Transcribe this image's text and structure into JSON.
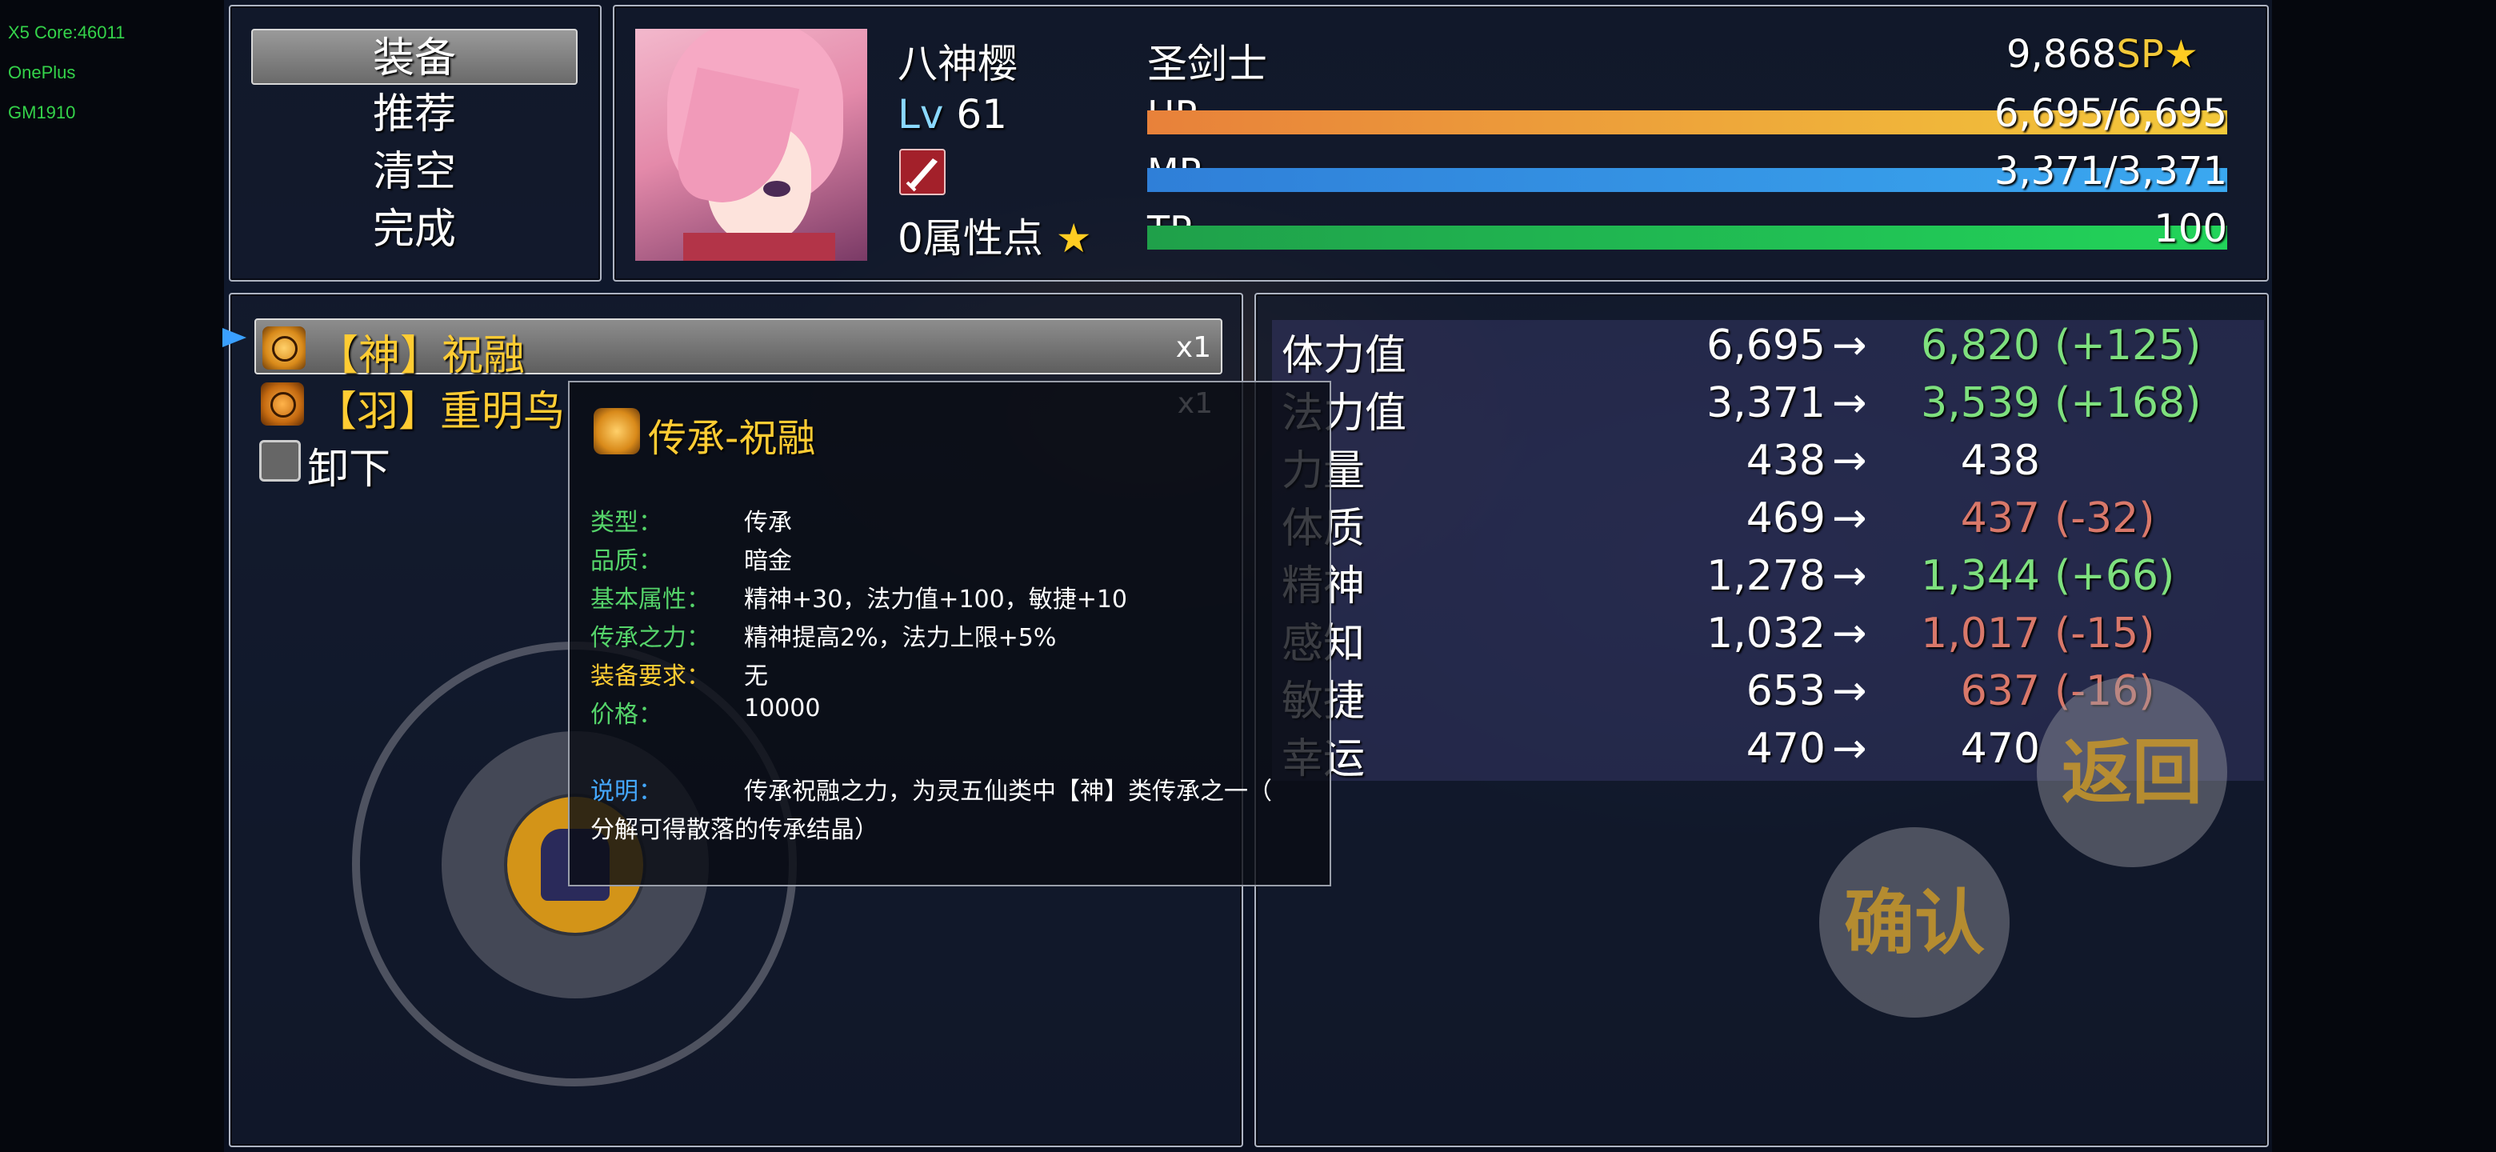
{
  "device": {
    "line1": "X5 Core:46011",
    "line2": "OnePlus",
    "line3": "GM1910"
  },
  "commands": [
    "装备",
    "推荐",
    "清空",
    "完成"
  ],
  "actor": {
    "name": "八神樱",
    "class": "圣剑士",
    "level_label": "Lv",
    "level": "61",
    "sp_value": "9,868",
    "sp_unit": "SP",
    "points_label": "0属性点",
    "hp_label": "HP",
    "hp_text": "6,695/6,695",
    "hp_ratio": 1.0,
    "mp_label": "MP",
    "mp_text": "3,371/3,371",
    "mp_ratio": 1.0,
    "tp_label": "TP",
    "tp_text": "100",
    "tp_ratio": 1.0
  },
  "items": [
    {
      "name": "【神】祝融",
      "count": "x1",
      "color": "#ffcc33"
    },
    {
      "name": "【羽】重明鸟",
      "count": "x1",
      "color": "#ffcc33"
    },
    {
      "name": "卸下",
      "count": "",
      "color": "#ffffff"
    }
  ],
  "tooltip": {
    "title": "传承-祝融",
    "rows": [
      {
        "k": "类型：",
        "v": "传承",
        "color": "#55d46a"
      },
      {
        "k": "品质：",
        "v": "暗金",
        "color": "#55d46a"
      },
      {
        "k": "基本属性：",
        "v": "精神+30，法力值+100，敏捷+10",
        "color": "#55d46a"
      },
      {
        "k": "传承之力：",
        "v": "精神提高2%，法力上限+5%",
        "color": "#55d46a"
      },
      {
        "k": "装备要求：",
        "v": "无",
        "color": "#ffcc33"
      },
      {
        "k": "价格：",
        "v": "10000",
        "color": "#55d46a"
      }
    ],
    "desc_label": "说明：",
    "desc_line1": "传承祝融之力，为灵五仙类中【神】类传承之一（",
    "desc_line2": "分解可得散落的传承结晶）"
  },
  "stats": [
    {
      "name": "体力值",
      "old": "6,695",
      "new": "6,820",
      "diff": "(+125)",
      "trend": "up"
    },
    {
      "name": "法力值",
      "old": "3,371",
      "new": "3,539",
      "diff": "(+168)",
      "trend": "up"
    },
    {
      "name": "力量",
      "old": "438",
      "new": "438",
      "diff": "",
      "trend": "same"
    },
    {
      "name": "体质",
      "old": "469",
      "new": "437",
      "diff": "(-32)",
      "trend": "down"
    },
    {
      "name": "精神",
      "old": "1,278",
      "new": "1,344",
      "diff": "(+66)",
      "trend": "up"
    },
    {
      "name": "感知",
      "old": "1,032",
      "new": "1,017",
      "diff": "(-15)",
      "trend": "down"
    },
    {
      "name": "敏捷",
      "old": "653",
      "new": "637",
      "diff": "(-16)",
      "trend": "down"
    },
    {
      "name": "幸运",
      "old": "470",
      "new": "470",
      "diff": "",
      "trend": "same"
    }
  ],
  "arrow": "→",
  "buttons": {
    "back": "返回",
    "confirm": "确认"
  },
  "colors": {
    "hp_from": "#e8813a",
    "hp_to": "#f3c93a",
    "mp_from": "#2f7fd8",
    "mp_to": "#3aa8f0",
    "tp_from": "#1fa04a",
    "tp_to": "#22d45a"
  }
}
